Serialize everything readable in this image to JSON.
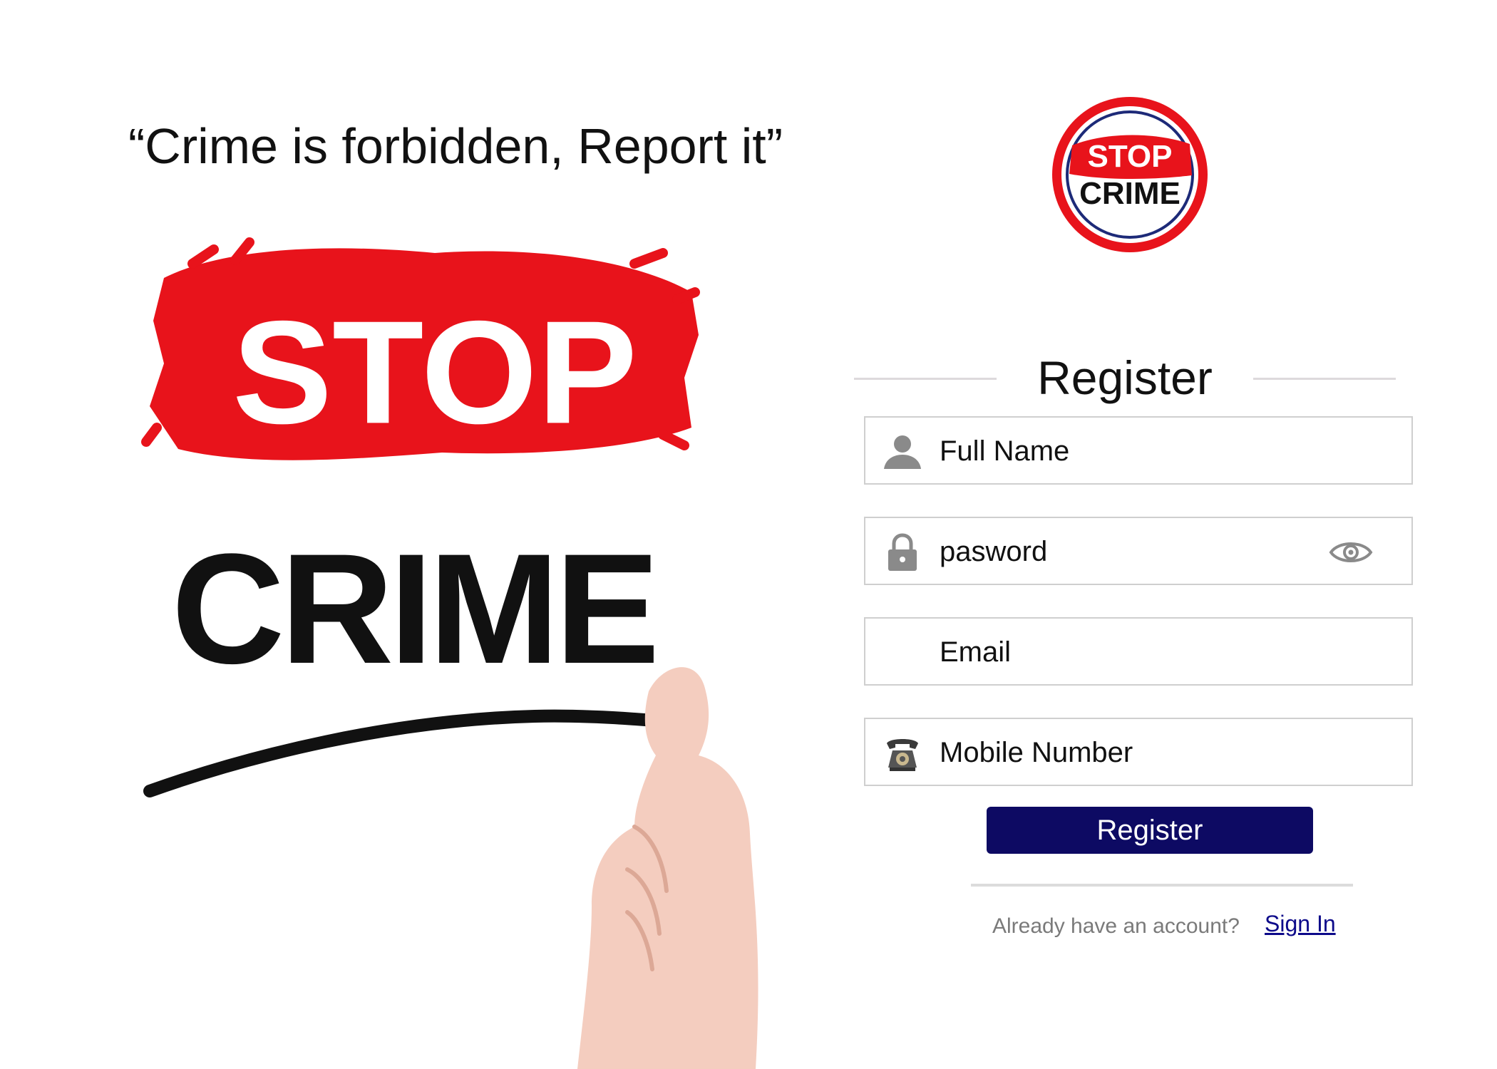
{
  "tagline": "“Crime is forbidden, Report it”",
  "hero": {
    "top_word": "STOP",
    "bottom_word": "CRIME"
  },
  "logo": {
    "top_word": "STOP",
    "bottom_word": "CRIME"
  },
  "form": {
    "title": "Register",
    "full_name_placeholder": "Full Name",
    "password_placeholder": "pasword",
    "email_placeholder": "Email",
    "mobile_placeholder": "Mobile Number",
    "submit_label": "Register",
    "have_account_text": "Already have an account?",
    "sign_in_label": "Sign In"
  },
  "icons": {
    "full_name": "person-icon",
    "password": "lock-icon",
    "password_toggle": "eye-icon",
    "mobile": "telephone-icon"
  },
  "colors": {
    "accent_red": "#e8131b",
    "button_navy": "#0d0a63",
    "link_blue": "#0d0a8a",
    "logo_ring_blue": "#1d2a78"
  }
}
